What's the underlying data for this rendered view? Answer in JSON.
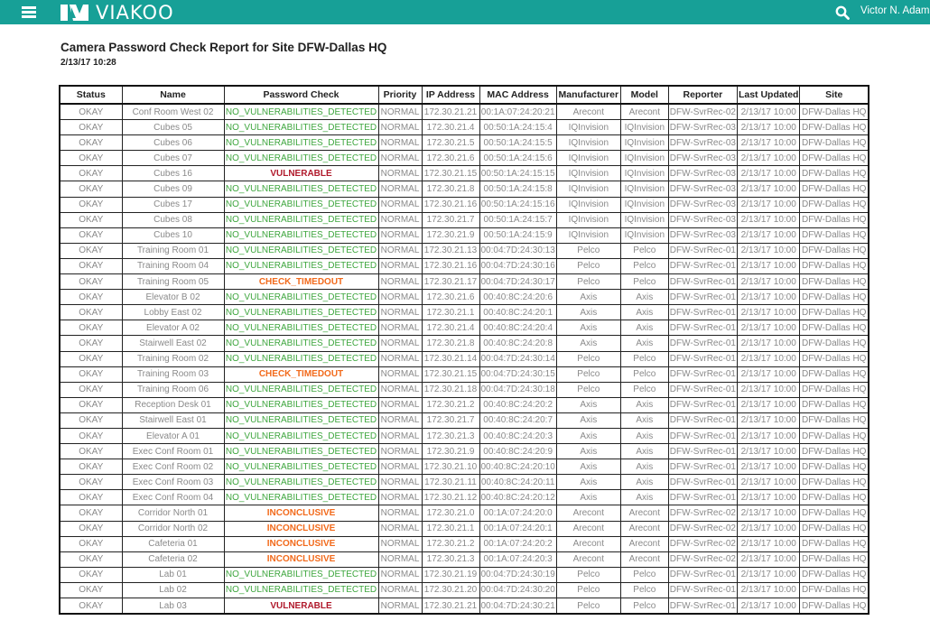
{
  "header": {
    "brand": "VIAKOO",
    "user_name": "Victor N. Adams",
    "menu_icon": "hamburger-menu-icon",
    "search_icon": "search-icon",
    "brand_color": "#17a097"
  },
  "report": {
    "title": "Camera Password Check Report for Site DFW-Dallas HQ",
    "date": "2/13/17 10:28",
    "status_colors": {
      "OKAY": "#3a9a3a",
      "NO_VULNERABILITIES_DETECTED": "#3ea63e",
      "VULNERABLE": "#b0192b",
      "CHECK_TIMEDOUT": "#f26a1b",
      "INCONCLUSIVE": "#f26a1b"
    },
    "columns": [
      "Status",
      "Name",
      "Password Check",
      "Priority",
      "IP Address",
      "MAC Address",
      "Manufacturer",
      "Model",
      "Reporter",
      "Last Updated",
      "Site"
    ],
    "rows": [
      [
        "OKAY",
        "Conf Room West 02",
        "NO_VULNERABILITIES_DETECTED",
        "NORMAL",
        "172.30.21.21",
        "00:1A:07:24:20:21",
        "Arecont",
        "Arecont",
        "DFW-SvrRec-02",
        "2/13/17 10:00",
        "DFW-Dallas HQ"
      ],
      [
        "OKAY",
        "Cubes 05",
        "NO_VULNERABILITIES_DETECTED",
        "NORMAL",
        "172.30.21.4",
        "00:50:1A:24:15:4",
        "IQInvision",
        "IQInvision",
        "DFW-SvrRec-03",
        "2/13/17 10:00",
        "DFW-Dallas HQ"
      ],
      [
        "OKAY",
        "Cubes 06",
        "NO_VULNERABILITIES_DETECTED",
        "NORMAL",
        "172.30.21.5",
        "00:50:1A:24:15:5",
        "IQInvision",
        "IQInvision",
        "DFW-SvrRec-03",
        "2/13/17 10:00",
        "DFW-Dallas HQ"
      ],
      [
        "OKAY",
        "Cubes 07",
        "NO_VULNERABILITIES_DETECTED",
        "NORMAL",
        "172.30.21.6",
        "00:50:1A:24:15:6",
        "IQInvision",
        "IQInvision",
        "DFW-SvrRec-03",
        "2/13/17 10:00",
        "DFW-Dallas HQ"
      ],
      [
        "OKAY",
        "Cubes 16",
        "VULNERABLE",
        "NORMAL",
        "172.30.21.15",
        "00:50:1A:24:15:15",
        "IQInvision",
        "IQInvision",
        "DFW-SvrRec-03",
        "2/13/17 10:00",
        "DFW-Dallas HQ"
      ],
      [
        "OKAY",
        "Cubes 09",
        "NO_VULNERABILITIES_DETECTED",
        "NORMAL",
        "172.30.21.8",
        "00:50:1A:24:15:8",
        "IQInvision",
        "IQInvision",
        "DFW-SvrRec-03",
        "2/13/17 10:00",
        "DFW-Dallas HQ"
      ],
      [
        "OKAY",
        "Cubes 17",
        "NO_VULNERABILITIES_DETECTED",
        "NORMAL",
        "172.30.21.16",
        "00:50:1A:24:15:16",
        "IQInvision",
        "IQInvision",
        "DFW-SvrRec-03",
        "2/13/17 10:00",
        "DFW-Dallas HQ"
      ],
      [
        "OKAY",
        "Cubes 08",
        "NO_VULNERABILITIES_DETECTED",
        "NORMAL",
        "172.30.21.7",
        "00:50:1A:24:15:7",
        "IQInvision",
        "IQInvision",
        "DFW-SvrRec-03",
        "2/13/17 10:00",
        "DFW-Dallas HQ"
      ],
      [
        "OKAY",
        "Cubes 10",
        "NO_VULNERABILITIES_DETECTED",
        "NORMAL",
        "172.30.21.9",
        "00:50:1A:24:15:9",
        "IQInvision",
        "IQInvision",
        "DFW-SvrRec-03",
        "2/13/17 10:00",
        "DFW-Dallas HQ"
      ],
      [
        "OKAY",
        "Training Room 01",
        "NO_VULNERABILITIES_DETECTED",
        "NORMAL",
        "172.30.21.13",
        "00:04:7D:24:30:13",
        "Pelco",
        "Pelco",
        "DFW-SvrRec-01",
        "2/13/17 10:00",
        "DFW-Dallas HQ"
      ],
      [
        "OKAY",
        "Training Room 04",
        "NO_VULNERABILITIES_DETECTED",
        "NORMAL",
        "172.30.21.16",
        "00:04:7D:24:30:16",
        "Pelco",
        "Pelco",
        "DFW-SvrRec-01",
        "2/13/17 10:00",
        "DFW-Dallas HQ"
      ],
      [
        "OKAY",
        "Training Room 05",
        "CHECK_TIMEDOUT",
        "NORMAL",
        "172.30.21.17",
        "00:04:7D:24:30:17",
        "Pelco",
        "Pelco",
        "DFW-SvrRec-01",
        "2/13/17 10:00",
        "DFW-Dallas HQ"
      ],
      [
        "OKAY",
        "Elevator B 02",
        "NO_VULNERABILITIES_DETECTED",
        "NORMAL",
        "172.30.21.6",
        "00:40:8C:24:20:6",
        "Axis",
        "Axis",
        "DFW-SvrRec-01",
        "2/13/17 10:00",
        "DFW-Dallas HQ"
      ],
      [
        "OKAY",
        "Lobby East 02",
        "NO_VULNERABILITIES_DETECTED",
        "NORMAL",
        "172.30.21.1",
        "00:40:8C:24:20:1",
        "Axis",
        "Axis",
        "DFW-SvrRec-01",
        "2/13/17 10:00",
        "DFW-Dallas HQ"
      ],
      [
        "OKAY",
        "Elevator A 02",
        "NO_VULNERABILITIES_DETECTED",
        "NORMAL",
        "172.30.21.4",
        "00:40:8C:24:20:4",
        "Axis",
        "Axis",
        "DFW-SvrRec-01",
        "2/13/17 10:00",
        "DFW-Dallas HQ"
      ],
      [
        "OKAY",
        "Stairwell East 02",
        "NO_VULNERABILITIES_DETECTED",
        "NORMAL",
        "172.30.21.8",
        "00:40:8C:24:20:8",
        "Axis",
        "Axis",
        "DFW-SvrRec-01",
        "2/13/17 10:00",
        "DFW-Dallas HQ"
      ],
      [
        "OKAY",
        "Training Room 02",
        "NO_VULNERABILITIES_DETECTED",
        "NORMAL",
        "172.30.21.14",
        "00:04:7D:24:30:14",
        "Pelco",
        "Pelco",
        "DFW-SvrRec-01",
        "2/13/17 10:00",
        "DFW-Dallas HQ"
      ],
      [
        "OKAY",
        "Training Room 03",
        "CHECK_TIMEDOUT",
        "NORMAL",
        "172.30.21.15",
        "00:04:7D:24:30:15",
        "Pelco",
        "Pelco",
        "DFW-SvrRec-01",
        "2/13/17 10:00",
        "DFW-Dallas HQ"
      ],
      [
        "OKAY",
        "Training Room 06",
        "NO_VULNERABILITIES_DETECTED",
        "NORMAL",
        "172.30.21.18",
        "00:04:7D:24:30:18",
        "Pelco",
        "Pelco",
        "DFW-SvrRec-01",
        "2/13/17 10:00",
        "DFW-Dallas HQ"
      ],
      [
        "OKAY",
        "Reception Desk 01",
        "NO_VULNERABILITIES_DETECTED",
        "NORMAL",
        "172.30.21.2",
        "00:40:8C:24:20:2",
        "Axis",
        "Axis",
        "DFW-SvrRec-01",
        "2/13/17 10:00",
        "DFW-Dallas HQ"
      ],
      [
        "OKAY",
        "Stairwell East 01",
        "NO_VULNERABILITIES_DETECTED",
        "NORMAL",
        "172.30.21.7",
        "00:40:8C:24:20:7",
        "Axis",
        "Axis",
        "DFW-SvrRec-01",
        "2/13/17 10:00",
        "DFW-Dallas HQ"
      ],
      [
        "OKAY",
        "Elevator A 01",
        "NO_VULNERABILITIES_DETECTED",
        "NORMAL",
        "172.30.21.3",
        "00:40:8C:24:20:3",
        "Axis",
        "Axis",
        "DFW-SvrRec-01",
        "2/13/17 10:00",
        "DFW-Dallas HQ"
      ],
      [
        "OKAY",
        "Exec Conf Room 01",
        "NO_VULNERABILITIES_DETECTED",
        "NORMAL",
        "172.30.21.9",
        "00:40:8C:24:20:9",
        "Axis",
        "Axis",
        "DFW-SvrRec-01",
        "2/13/17 10:00",
        "DFW-Dallas HQ"
      ],
      [
        "OKAY",
        "Exec Conf Room 02",
        "NO_VULNERABILITIES_DETECTED",
        "NORMAL",
        "172.30.21.10",
        "00:40:8C:24:20:10",
        "Axis",
        "Axis",
        "DFW-SvrRec-01",
        "2/13/17 10:00",
        "DFW-Dallas HQ"
      ],
      [
        "OKAY",
        "Exec Conf Room 03",
        "NO_VULNERABILITIES_DETECTED",
        "NORMAL",
        "172.30.21.11",
        "00:40:8C:24:20:11",
        "Axis",
        "Axis",
        "DFW-SvrRec-01",
        "2/13/17 10:00",
        "DFW-Dallas HQ"
      ],
      [
        "OKAY",
        "Exec Conf Room 04",
        "NO_VULNERABILITIES_DETECTED",
        "NORMAL",
        "172.30.21.12",
        "00:40:8C:24:20:12",
        "Axis",
        "Axis",
        "DFW-SvrRec-01",
        "2/13/17 10:00",
        "DFW-Dallas HQ"
      ],
      [
        "OKAY",
        "Corridor North 01",
        "INCONCLUSIVE",
        "NORMAL",
        "172.30.21.0",
        "00:1A:07:24:20:0",
        "Arecont",
        "Arecont",
        "DFW-SvrRec-02",
        "2/13/17 10:00",
        "DFW-Dallas HQ"
      ],
      [
        "OKAY",
        "Corridor North 02",
        "INCONCLUSIVE",
        "NORMAL",
        "172.30.21.1",
        "00:1A:07:24:20:1",
        "Arecont",
        "Arecont",
        "DFW-SvrRec-02",
        "2/13/17 10:00",
        "DFW-Dallas HQ"
      ],
      [
        "OKAY",
        "Cafeteria 01",
        "INCONCLUSIVE",
        "NORMAL",
        "172.30.21.2",
        "00:1A:07:24:20:2",
        "Arecont",
        "Arecont",
        "DFW-SvrRec-02",
        "2/13/17 10:00",
        "DFW-Dallas HQ"
      ],
      [
        "OKAY",
        "Cafeteria 02",
        "INCONCLUSIVE",
        "NORMAL",
        "172.30.21.3",
        "00:1A:07:24:20:3",
        "Arecont",
        "Arecont",
        "DFW-SvrRec-02",
        "2/13/17 10:00",
        "DFW-Dallas HQ"
      ],
      [
        "OKAY",
        "Lab 01",
        "NO_VULNERABILITIES_DETECTED",
        "NORMAL",
        "172.30.21.19",
        "00:04:7D:24:30:19",
        "Pelco",
        "Pelco",
        "DFW-SvrRec-01",
        "2/13/17 10:00",
        "DFW-Dallas HQ"
      ],
      [
        "OKAY",
        "Lab 02",
        "NO_VULNERABILITIES_DETECTED",
        "NORMAL",
        "172.30.21.20",
        "00:04:7D:24:30:20",
        "Pelco",
        "Pelco",
        "DFW-SvrRec-01",
        "2/13/17 10:00",
        "DFW-Dallas HQ"
      ],
      [
        "OKAY",
        "Lab 03",
        "VULNERABLE",
        "NORMAL",
        "172.30.21.21",
        "00:04:7D:24:30:21",
        "Pelco",
        "Pelco",
        "DFW-SvrRec-01",
        "2/13/17 10:00",
        "DFW-Dallas HQ"
      ]
    ]
  }
}
